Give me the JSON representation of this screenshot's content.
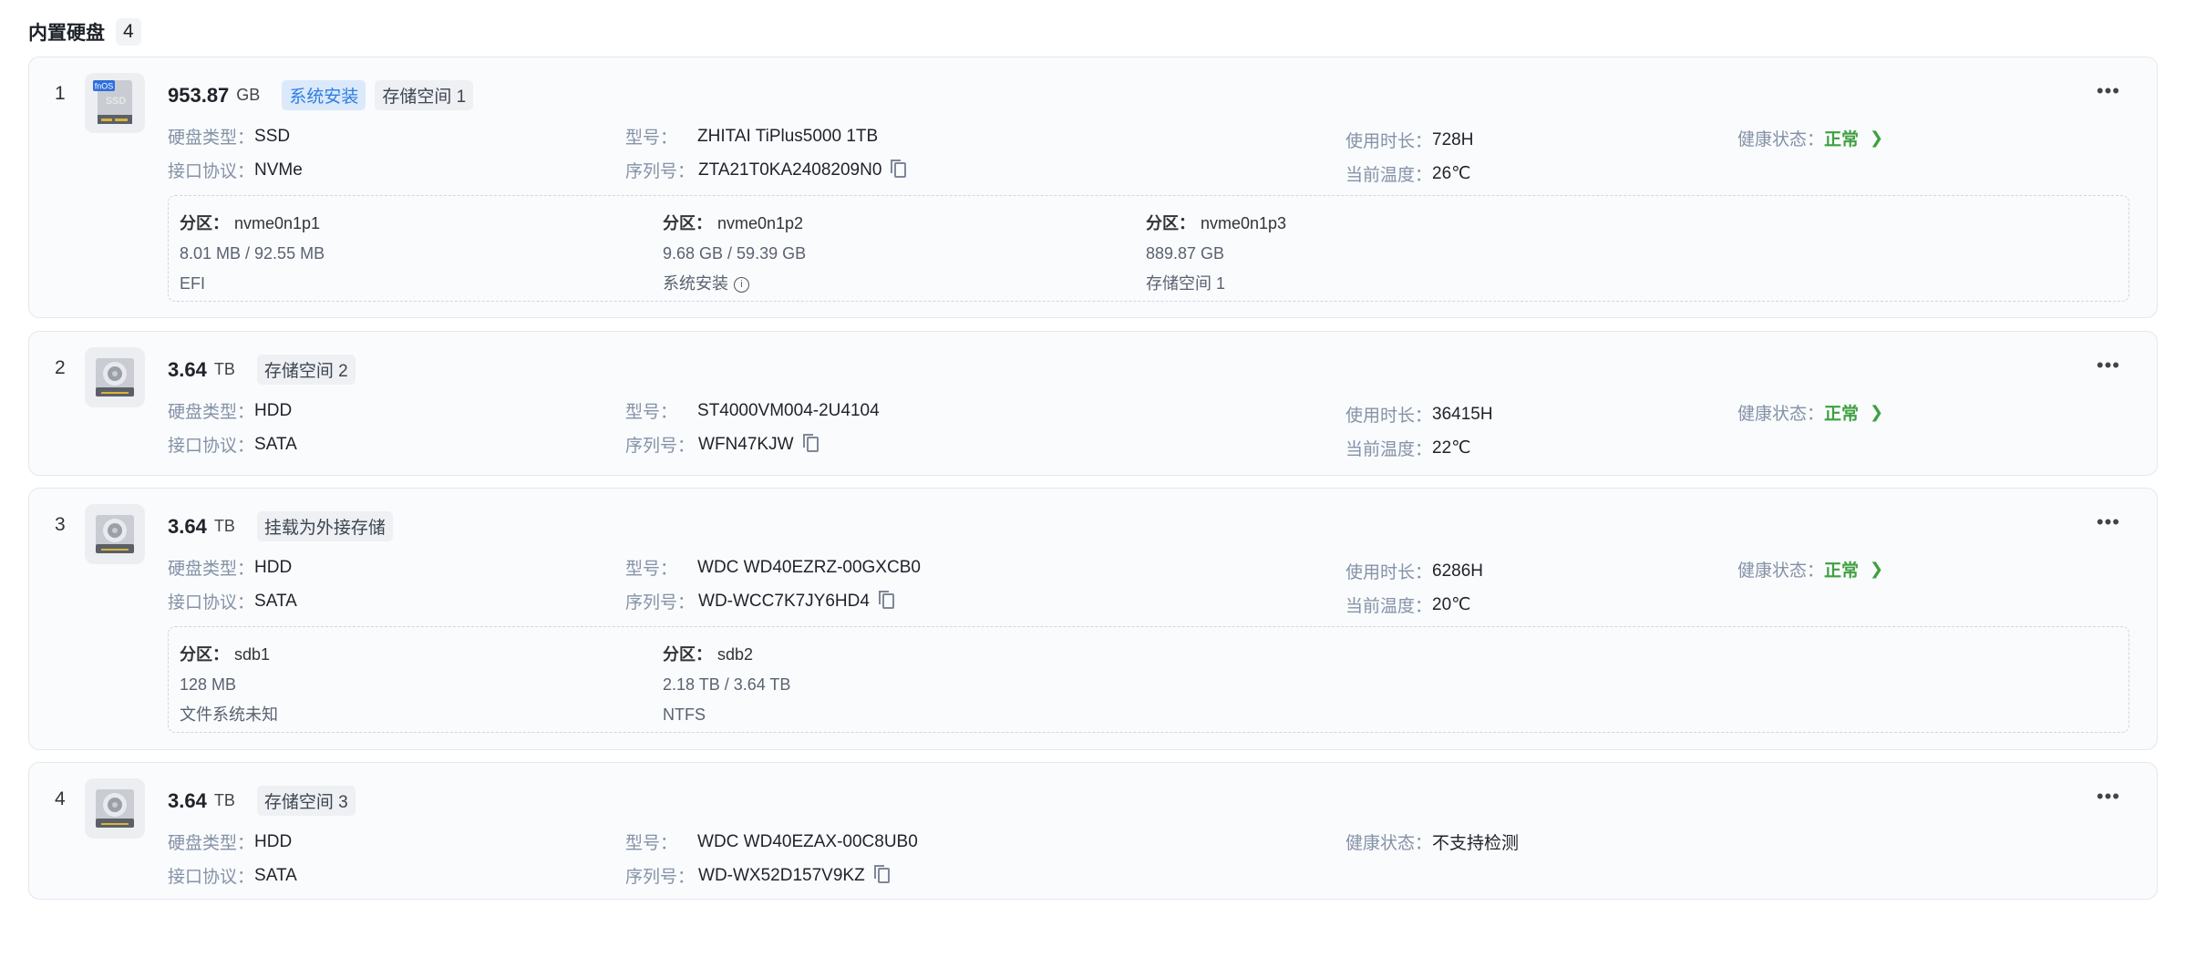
{
  "heading": {
    "title": "内置硬盘",
    "count": "4"
  },
  "labels": {
    "type": "硬盘类型：",
    "protocol": "接口协议：",
    "model": "型号：",
    "serial": "序列号：",
    "hours": "使用时长：",
    "temp": "当前温度：",
    "health": "健康状态：",
    "partition": "分区："
  },
  "disks": [
    {
      "index": "1",
      "size": "953.87",
      "unit": "GB",
      "icon": "ssd-icon",
      "icon_text": [
        "fnOS",
        "SSD"
      ],
      "tags": [
        "系统安装",
        "存储空间 1"
      ],
      "type": "SSD",
      "protocol": "NVMe",
      "model": "ZHITAI TiPlus5000 1TB",
      "serial": "ZTA21T0KA2408209N0",
      "hours": "728H",
      "temp": "26℃",
      "health": "正常",
      "partitions": [
        {
          "name": "nvme0n1p1",
          "usage": "8.01 MB / 92.55 MB",
          "fs": "EFI"
        },
        {
          "name": "nvme0n1p2",
          "usage": "9.68 GB / 59.39 GB",
          "fs": "系统安装"
        },
        {
          "name": "nvme0n1p3",
          "usage": "889.87 GB",
          "fs": "存储空间 1"
        }
      ]
    },
    {
      "index": "2",
      "size": "3.64",
      "unit": "TB",
      "icon": "hdd-icon",
      "tags": [
        "存储空间 2"
      ],
      "type": "HDD",
      "protocol": "SATA",
      "model": "ST4000VM004-2U4104",
      "serial": "WFN47KJW",
      "hours": "36415H",
      "temp": "22℃",
      "health": "正常"
    },
    {
      "index": "3",
      "size": "3.64",
      "unit": "TB",
      "icon": "hdd-icon",
      "tags": [
        "挂载为外接存储"
      ],
      "type": "HDD",
      "protocol": "SATA",
      "model": "WDC WD40EZRZ-00GXCB0",
      "serial": "WD-WCC7K7JY6HD4",
      "hours": "6286H",
      "temp": "20℃",
      "health": "正常",
      "partitions": [
        {
          "name": "sdb1",
          "usage": "128 MB",
          "fs": "文件系统未知"
        },
        {
          "name": "sdb2",
          "usage": "2.18 TB / 3.64 TB",
          "fs": "NTFS"
        }
      ]
    },
    {
      "index": "4",
      "size": "3.64",
      "unit": "TB",
      "icon": "hdd-icon",
      "tags": [
        "存储空间 3"
      ],
      "type": "HDD",
      "protocol": "SATA",
      "model": "WDC WD40EZAX-00C8UB0",
      "serial": "WD-WX52D157V9KZ",
      "health": "不支持检测"
    }
  ],
  "colors": {
    "ok": "#3ea040",
    "tag_blue": "#2f7de1"
  }
}
